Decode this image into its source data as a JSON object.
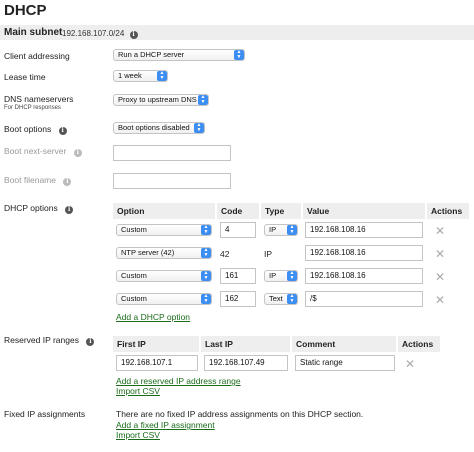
{
  "page": {
    "title": "DHCP",
    "subnet_label": "Main subnet",
    "subnet_value": "192.168.107.0/24"
  },
  "fields": {
    "client_addressing_label": "Client addressing",
    "client_addressing_value": "Run a DHCP server",
    "lease_time_label": "Lease time",
    "lease_time_value": "1 week",
    "dns_label": "DNS nameservers",
    "dns_sublabel": "For DHCP responses",
    "dns_value": "Proxy to upstream DNS",
    "boot_options_label": "Boot options",
    "boot_options_value": "Boot options disabled",
    "boot_next_server_label": "Boot next-server",
    "boot_filename_label": "Boot filename"
  },
  "dhcp_options": {
    "label": "DHCP options",
    "headers": {
      "option": "Option",
      "code": "Code",
      "type": "Type",
      "value": "Value",
      "actions": "Actions"
    },
    "rows": [
      {
        "option": "Custom",
        "code": "4",
        "type": "IP",
        "value": "192.168.108.16"
      },
      {
        "option": "NTP server (42)",
        "code": "42",
        "type": "IP",
        "value": "192.168.108.16"
      },
      {
        "option": "Custom",
        "code": "161",
        "type": "IP",
        "value": "192.168.108.16"
      },
      {
        "option": "Custom",
        "code": "162",
        "type": "Text",
        "value": "/$"
      }
    ],
    "add_link": "Add a DHCP option"
  },
  "reserved": {
    "label": "Reserved IP ranges",
    "headers": {
      "first": "First IP",
      "last": "Last IP",
      "comment": "Comment",
      "actions": "Actions"
    },
    "rows": [
      {
        "first": "192.168.107.1",
        "last": "192.168.107.49",
        "comment": "Static range"
      }
    ],
    "add_link": "Add a reserved IP address range",
    "import_link": "Import CSV"
  },
  "fixed": {
    "label": "Fixed IP assignments",
    "message": "There are no fixed IP address assignments on this DHCP section.",
    "add_link": "Add a fixed IP assignment",
    "import_link": "Import CSV"
  },
  "colors": {
    "accent": "#3d8ef3",
    "link": "#1a6b1a",
    "header_bg": "#eeeeee"
  }
}
